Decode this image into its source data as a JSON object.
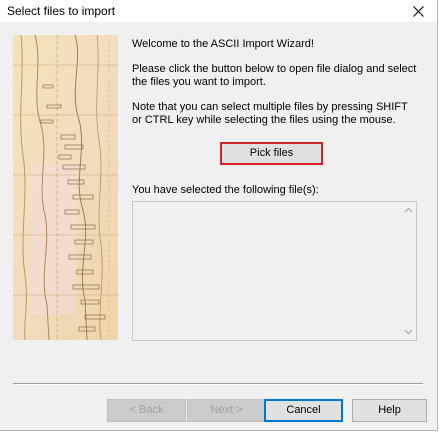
{
  "window": {
    "title": "Select files to import"
  },
  "content": {
    "welcome": "Welcome to the ASCII Import Wizard!",
    "instructions": "Please click the button below to open file dialog and select the files you want to import.",
    "note": "Note that you can select multiple files by pressing SHIFT or CTRL key while selecting the files using the mouse.",
    "pick_files_label": "Pick files",
    "selected_label": "You have selected the following file(s):",
    "selected_files": []
  },
  "footer": {
    "back_label": "< Back",
    "next_label": "Next >",
    "cancel_label": "Cancel",
    "help_label": "Help"
  },
  "icons": {
    "close": "close-icon",
    "scroll_up": "chevron-up-icon",
    "scroll_down": "chevron-down-icon"
  },
  "colors": {
    "highlight_border": "#d2232a",
    "focus_border": "#0078d7",
    "dialog_background": "#f0f0f0"
  }
}
